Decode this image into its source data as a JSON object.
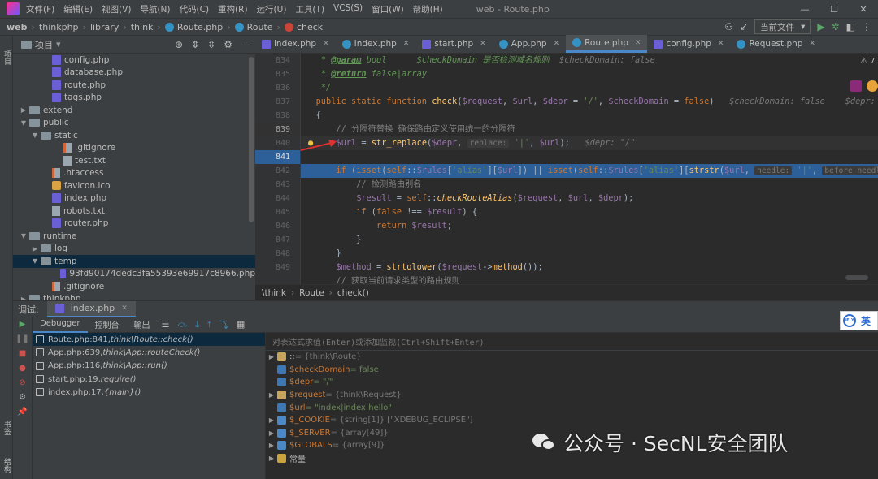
{
  "menubar": {
    "items": [
      "文件(F)",
      "编辑(E)",
      "视图(V)",
      "导航(N)",
      "代码(C)",
      "重构(R)",
      "运行(U)",
      "工具(T)",
      "VCS(S)",
      "窗口(W)",
      "帮助(H)"
    ],
    "window_title": "web - Route.php"
  },
  "navbar": {
    "crumbs": [
      "web",
      "thinkphp",
      "library",
      "think",
      "Route.php",
      "Route",
      "check"
    ],
    "run_config": "当前文件"
  },
  "project": {
    "title": "项目",
    "side_labels": [
      "项目",
      "书签",
      "结构"
    ]
  },
  "tree": [
    {
      "label": "config.php",
      "indent": 3,
      "icon": "php",
      "arrow": ""
    },
    {
      "label": "database.php",
      "indent": 3,
      "icon": "php",
      "arrow": ""
    },
    {
      "label": "route.php",
      "indent": 3,
      "icon": "php",
      "arrow": ""
    },
    {
      "label": "tags.php",
      "indent": 3,
      "icon": "php",
      "arrow": ""
    },
    {
      "label": "extend",
      "indent": 1,
      "icon": "folder",
      "arrow": "▶"
    },
    {
      "label": "public",
      "indent": 1,
      "icon": "folder",
      "arrow": "▼"
    },
    {
      "label": "static",
      "indent": 2,
      "icon": "folder",
      "arrow": "▼"
    },
    {
      "label": ".gitignore",
      "indent": 4,
      "icon": "git",
      "arrow": ""
    },
    {
      "label": "test.txt",
      "indent": 4,
      "icon": "txt",
      "arrow": ""
    },
    {
      "label": ".htaccess",
      "indent": 3,
      "icon": "git",
      "arrow": ""
    },
    {
      "label": "favicon.ico",
      "indent": 3,
      "icon": "ico",
      "arrow": ""
    },
    {
      "label": "index.php",
      "indent": 3,
      "icon": "php",
      "arrow": ""
    },
    {
      "label": "robots.txt",
      "indent": 3,
      "icon": "txt",
      "arrow": ""
    },
    {
      "label": "router.php",
      "indent": 3,
      "icon": "php",
      "arrow": ""
    },
    {
      "label": "runtime",
      "indent": 1,
      "icon": "folder",
      "arrow": "▼"
    },
    {
      "label": "log",
      "indent": 2,
      "icon": "folder",
      "arrow": "▶"
    },
    {
      "label": "temp",
      "indent": 2,
      "icon": "folder",
      "arrow": "▼",
      "selected": true
    },
    {
      "label": "93fd90174dedc3fa55393e69917c8966.php",
      "indent": 4,
      "icon": "php",
      "arrow": ""
    },
    {
      "label": ".gitignore",
      "indent": 3,
      "icon": "git",
      "arrow": ""
    },
    {
      "label": "thinkphp",
      "indent": 1,
      "icon": "folder",
      "arrow": "▶"
    }
  ],
  "tabs": [
    {
      "label": "index.php",
      "type": "php"
    },
    {
      "label": "Index.php",
      "type": "class"
    },
    {
      "label": "start.php",
      "type": "php"
    },
    {
      "label": "App.php",
      "type": "class"
    },
    {
      "label": "Route.php",
      "type": "class",
      "active": true
    },
    {
      "label": "config.php",
      "type": "php"
    },
    {
      "label": "Request.php",
      "type": "class"
    }
  ],
  "editor": {
    "line_numbers": [
      "834",
      "835",
      "836",
      "837",
      "838",
      "839",
      "840",
      "841",
      "842",
      "843",
      "844",
      "845",
      "846",
      "847",
      "848",
      "849"
    ],
    "warnings": "⚠ 7",
    "breadcrumb": [
      "\\think",
      "Route",
      "check()"
    ]
  },
  "debug": {
    "title": "调试:",
    "session_tab": "index.php",
    "tabs": [
      "Debugger",
      "控制台",
      "输出"
    ],
    "frames": [
      {
        "label": "Route.php:841, ",
        "italic": "think\\Route::check()",
        "selected": true
      },
      {
        "label": "App.php:639, ",
        "italic": "think\\App::routeCheck()"
      },
      {
        "label": "App.php:116, ",
        "italic": "think\\App::run()"
      },
      {
        "label": "start.php:19, ",
        "italic": "require()"
      },
      {
        "label": "index.php:17, ",
        "italic": "{main}()"
      }
    ],
    "eval_placeholder": "对表达式求值(Enter)或添加监视(Ctrl+Shift+Enter)",
    "vars": [
      {
        "name": "::",
        "value": " = {think\\Route}",
        "expand": "▶",
        "color": "#c8a45d"
      },
      {
        "name": "$checkDomain",
        "value": " = false",
        "expand": "",
        "color": "#3d78b5"
      },
      {
        "name": "$depr",
        "value": " = \"/\"",
        "expand": "",
        "color": "#3d78b5"
      },
      {
        "name": "$request",
        "value": " = {think\\Request}",
        "expand": "▶",
        "color": "#c8a45d"
      },
      {
        "name": "$url",
        "value": " = \"index|index|hello\"",
        "expand": "",
        "color": "#3d78b5"
      },
      {
        "name": "$_COOKIE",
        "value": " = {string[1]} [\"XDEBUG_ECLIPSE\"]",
        "expand": "▶",
        "color": "#4a88c7"
      },
      {
        "name": "$_SERVER",
        "value": " = {array[49]}",
        "expand": "▶",
        "color": "#4a88c7"
      },
      {
        "name": "$GLOBALS",
        "value": " = {array[9]}",
        "expand": "▶",
        "color": "#4a88c7"
      },
      {
        "name": "常量",
        "value": "",
        "expand": "▶",
        "color": "#c9a43d"
      }
    ]
  },
  "ime": {
    "label": "英",
    "logo": "iFLY"
  },
  "watermark": {
    "text": "公众号 · SecNL安全团队"
  },
  "colors": {
    "bg": "#2b2b2b",
    "panel": "#3c3f41",
    "selection": "#2d6099",
    "accent": "#4a88c7"
  }
}
